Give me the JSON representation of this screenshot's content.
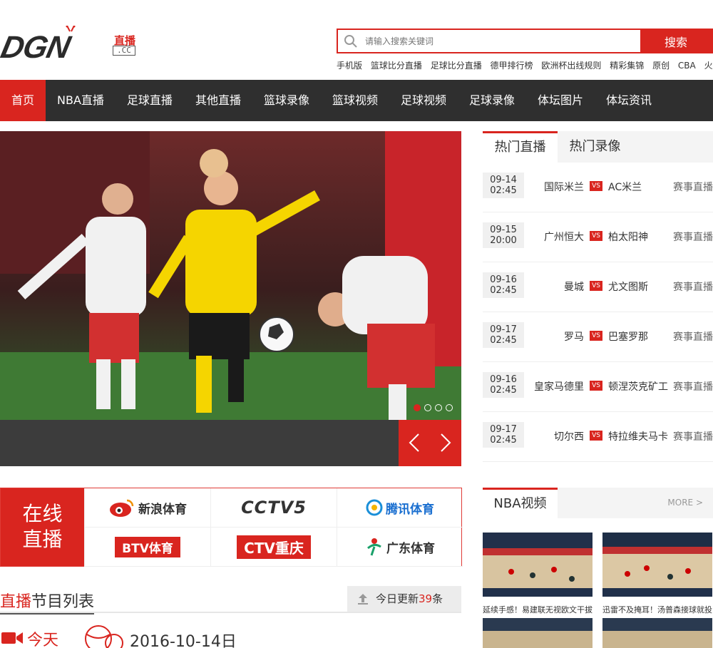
{
  "logo": {
    "text": "DGN",
    "tv": "直播",
    "cc": ".CC"
  },
  "search": {
    "placeholder": "请输入搜索关键词",
    "button": "搜索"
  },
  "hotlinks": [
    "手机版",
    "篮球比分直播",
    "足球比分直播",
    "德甲排行榜",
    "欧洲杯出线规则",
    "精彩集锦",
    "原创",
    "CBA",
    "火箭"
  ],
  "nav": [
    "首页",
    "NBA直播",
    "足球直播",
    "其他直播",
    "篮球录像",
    "篮球视频",
    "足球视频",
    "足球录像",
    "体坛图片",
    "体坛资讯"
  ],
  "hot": {
    "tabs": [
      "热门直播",
      "热门录像"
    ],
    "matches": [
      {
        "date": "09-14",
        "time": "02:45",
        "home": "国际米兰",
        "away": "AC米兰",
        "link": "赛事直播"
      },
      {
        "date": "09-15",
        "time": "20:00",
        "home": "广州恒大",
        "away": "柏太阳神",
        "link": "赛事直播"
      },
      {
        "date": "09-16",
        "time": "02:45",
        "home": "曼城",
        "away": "尤文图斯",
        "link": "赛事直播"
      },
      {
        "date": "09-17",
        "time": "02:45",
        "home": "罗马",
        "away": "巴塞罗那",
        "link": "赛事直播"
      },
      {
        "date": "09-16",
        "time": "02:45",
        "home": "皇家马德里",
        "away": "顿涅茨克矿工",
        "link": "赛事直播"
      },
      {
        "date": "09-17",
        "time": "02:45",
        "home": "切尔西",
        "away": "特拉维夫马卡",
        "link": "赛事直播"
      }
    ],
    "vs": "VS"
  },
  "live": {
    "label1": "在线",
    "label2": "直播",
    "channels": [
      "新浪体育",
      "CCTV5",
      "腾讯体育",
      "BTV体育",
      "CTV重庆",
      "广东体育"
    ]
  },
  "program": {
    "title_red": "直播",
    "title_rest": "节目列表",
    "update_pre": "今日更新",
    "update_count": "39",
    "update_post": "条"
  },
  "today": {
    "label": "今天",
    "date": "2016-10-14日"
  },
  "nba": {
    "title": "NBA视频",
    "more": "MORE >",
    "videos": [
      "延续手感！易建联无视欧文干拔三",
      "迅雷不及掩耳！汤普森接球就投三"
    ]
  },
  "colors": {
    "accent": "#d9251f",
    "nav": "#2f2f2f"
  }
}
